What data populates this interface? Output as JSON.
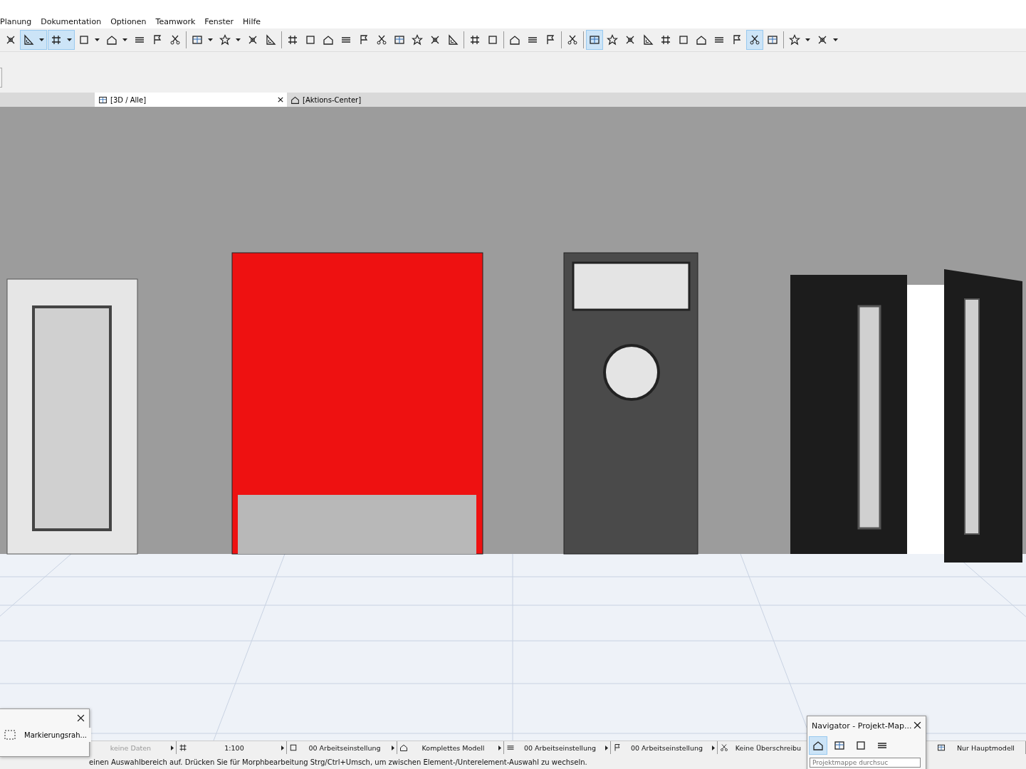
{
  "menu": [
    "Planung",
    "Dokumentation",
    "Optionen",
    "Teamwork",
    "Fenster",
    "Hilfe"
  ],
  "toolbar": {
    "groups": [
      [
        {
          "selected": false,
          "has_menu": false
        },
        {
          "selected": true,
          "has_menu": true
        },
        {
          "selected": true,
          "has_menu": true
        },
        {
          "selected": false,
          "has_menu": true
        },
        {
          "selected": false,
          "has_menu": true
        },
        {
          "selected": false,
          "has_menu": false
        },
        {
          "selected": false,
          "has_menu": false
        },
        {
          "selected": false,
          "has_menu": false
        }
      ],
      [
        {
          "selected": false,
          "has_menu": true
        },
        {
          "selected": false,
          "has_menu": true
        },
        {
          "selected": false,
          "has_menu": false
        },
        {
          "selected": false,
          "has_menu": false
        }
      ],
      [
        {
          "selected": false,
          "has_menu": false
        },
        {
          "selected": false,
          "has_menu": false
        },
        {
          "selected": false,
          "has_menu": false
        },
        {
          "selected": false,
          "has_menu": false
        },
        {
          "selected": false,
          "has_menu": false
        },
        {
          "selected": false,
          "has_menu": false
        },
        {
          "selected": false,
          "has_menu": false
        },
        {
          "selected": false,
          "has_menu": false
        },
        {
          "selected": false,
          "has_menu": false
        },
        {
          "selected": false,
          "has_menu": false
        }
      ],
      [
        {
          "selected": false,
          "has_menu": false
        },
        {
          "selected": false,
          "has_menu": false
        }
      ],
      [
        {
          "selected": false,
          "has_menu": false
        },
        {
          "selected": false,
          "has_menu": false
        },
        {
          "selected": false,
          "has_menu": false
        }
      ],
      [
        {
          "selected": false,
          "has_menu": false
        }
      ],
      [
        {
          "selected": true,
          "has_menu": false
        },
        {
          "selected": false,
          "has_menu": false
        },
        {
          "selected": false,
          "has_menu": false
        },
        {
          "selected": false,
          "has_menu": false
        },
        {
          "selected": false,
          "has_menu": false
        },
        {
          "selected": false,
          "has_menu": false
        },
        {
          "selected": false,
          "has_menu": false
        },
        {
          "selected": false,
          "has_menu": false
        },
        {
          "selected": false,
          "has_menu": false
        },
        {
          "selected": true,
          "has_menu": false
        },
        {
          "selected": false,
          "has_menu": false
        }
      ],
      [
        {
          "selected": false,
          "has_menu": true
        },
        {
          "selected": false,
          "has_menu": true
        }
      ]
    ]
  },
  "tabs": [
    {
      "label": "[3D / Alle]",
      "selected": true,
      "closable": true
    },
    {
      "label": "[Aktions-Center]",
      "selected": false,
      "closable": false
    }
  ],
  "status_bar": {
    "cells": [
      {
        "label": "keine Daten",
        "disabled": true
      },
      {
        "label": "1:100",
        "disabled": false
      },
      {
        "label": "00 Arbeitseinstellung",
        "disabled": false
      },
      {
        "label": "Komplettes Modell",
        "disabled": false
      },
      {
        "label": "00 Arbeitseinstellung",
        "disabled": false
      },
      {
        "label": "00 Arbeitseinstellung",
        "disabled": false
      },
      {
        "label": "Keine Überschreibu",
        "disabled": false
      },
      {
        "label": "Nur Hauptmodell",
        "disabled": false
      }
    ]
  },
  "message": "einen Auswahlbereich auf. Drücken Sie für Morphbearbeitung Strg/Ctrl+Umsch, um zwischen Element-/Unterelement-Auswahl zu wechseln.",
  "selection_palette": {
    "item": "Markierungsrah..."
  },
  "navigator": {
    "title": "Navigator - Projekt-Map...",
    "buttons": [
      {
        "selected": true
      },
      {
        "selected": false
      },
      {
        "selected": false
      },
      {
        "selected": false
      }
    ],
    "search": {
      "placeholder": "Projektmappe durchsuc"
    }
  }
}
